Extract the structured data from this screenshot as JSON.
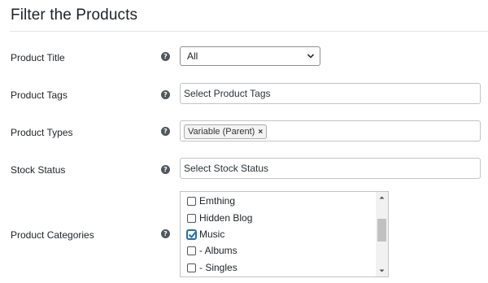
{
  "heading": "Filter the Products",
  "rows": {
    "product_title": {
      "label": "Product Title",
      "value": "All"
    },
    "product_tags": {
      "label": "Product Tags",
      "placeholder": "Select Product Tags"
    },
    "product_types": {
      "label": "Product Types",
      "tags": [
        "Variable (Parent)"
      ],
      "remove_glyph": "×"
    },
    "stock_status": {
      "label": "Stock Status",
      "placeholder": "Select Stock Status"
    },
    "product_categories": {
      "label": "Product Categories",
      "options": [
        {
          "label": "Emthing",
          "checked": false
        },
        {
          "label": "Hidden Blog",
          "checked": false
        },
        {
          "label": "Music",
          "checked": true
        },
        {
          "label": "- Albums",
          "checked": false
        },
        {
          "label": "- Singles",
          "checked": false
        }
      ]
    }
  },
  "help_glyph": "?",
  "colors": {
    "accent": "#2271b1",
    "text": "#1d2327",
    "help_bg": "#50575e"
  }
}
